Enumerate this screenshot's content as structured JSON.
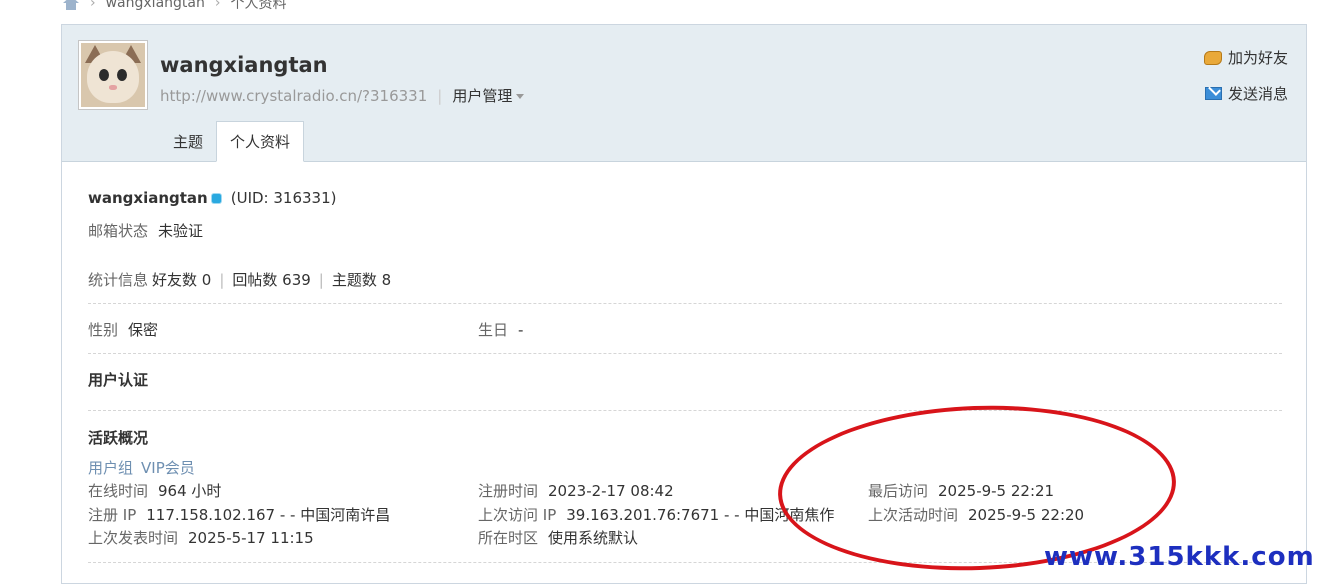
{
  "breadcrumb": {
    "items": [
      "wangxiangtan",
      "个人资料"
    ]
  },
  "header": {
    "username": "wangxiangtan",
    "url": "http://www.crystalradio.cn/?316331",
    "manage_label": "用户管理",
    "actions": {
      "add_friend": "加为好友",
      "send_message": "发送消息"
    },
    "tabs": [
      {
        "label": "主题"
      },
      {
        "label": "个人资料"
      }
    ]
  },
  "profile": {
    "username": "wangxiangtan",
    "uid": "(UID: 316331)",
    "email_status_label": "邮箱状态",
    "email_status_value": "未验证",
    "stats": {
      "label": "统计信息",
      "friends": "好友数 0",
      "replies": "回帖数 639",
      "threads": "主题数 8"
    },
    "gender_label": "性别",
    "gender_value": "保密",
    "birthday_label": "生日",
    "birthday_value": "-",
    "auth_title": "用户认证",
    "activity": {
      "title": "活跃概况",
      "group_label": "用户组",
      "group_value": "VIP会员",
      "online_label": "在线时间",
      "online_value": "964 小时",
      "reg_time_label": "注册时间",
      "reg_time_value": "2023-2-17 08:42",
      "last_visit_label": "最后访问",
      "last_visit_value": "2025-9-5 22:21",
      "reg_ip_label": "注册 IP",
      "reg_ip_value": "117.158.102.167 - - 中国河南许昌",
      "last_ip_label": "上次访问 IP",
      "last_ip_value": "39.163.201.76:7671 - - 中国河南焦作",
      "last_active_label": "上次活动时间",
      "last_active_value": "2025-9-5 22:20",
      "last_post_label": "上次发表时间",
      "last_post_value": "2025-5-17 11:15",
      "timezone_label": "所在时区",
      "timezone_value": "使用系统默认"
    }
  },
  "watermark": "www.315kkk.com"
}
